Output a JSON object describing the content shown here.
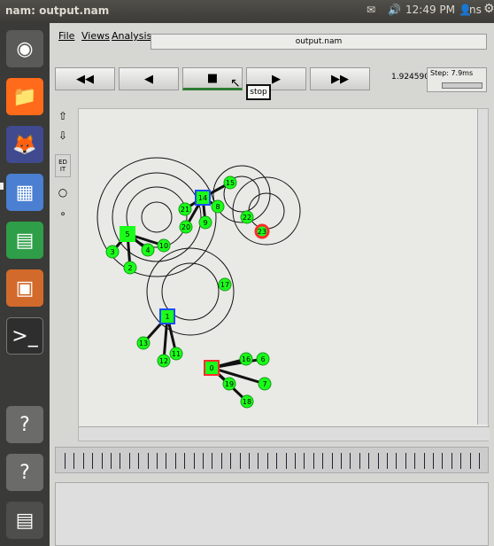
{
  "panel": {
    "title": "nam: output.nam",
    "clock": "12:49 PM",
    "user": "ns"
  },
  "menu": {
    "file": "File",
    "views": "Views",
    "analysis": "Analysis"
  },
  "filename": "output.nam",
  "controls": {
    "rewind_icon": "rewind-icon",
    "back_icon": "back-icon",
    "stop_icon": "stop-icon",
    "play_icon": "play-icon",
    "fastforward_icon": "fastforward-icon",
    "time": "1.924590",
    "step_label": "Step: 7.9ms",
    "tooltip": "stop"
  },
  "side_tools": {
    "edit": "ED IT"
  },
  "nodes": [
    {
      "id": "0",
      "color": "#ff2b2b",
      "type": "square"
    },
    {
      "id": "1",
      "color": "#1e4cff",
      "type": "square"
    },
    {
      "id": "2",
      "color": "#1aff1a",
      "type": "circle"
    },
    {
      "id": "3",
      "color": "#1aff1a",
      "type": "circle"
    },
    {
      "id": "4",
      "color": "#1aff1a",
      "type": "circle"
    },
    {
      "id": "5",
      "color": "#1aff1a",
      "type": "square"
    },
    {
      "id": "6",
      "color": "#1aff1a",
      "type": "circle"
    },
    {
      "id": "7",
      "color": "#1aff1a",
      "type": "circle"
    },
    {
      "id": "8",
      "color": "#1aff1a",
      "type": "circle"
    },
    {
      "id": "9",
      "color": "#1aff1a",
      "type": "circle"
    },
    {
      "id": "10",
      "color": "#1aff1a",
      "type": "circle"
    },
    {
      "id": "11",
      "color": "#1aff1a",
      "type": "circle"
    },
    {
      "id": "12",
      "color": "#1aff1a",
      "type": "circle"
    },
    {
      "id": "13",
      "color": "#1aff1a",
      "type": "circle"
    },
    {
      "id": "14",
      "color": "#1e4cff",
      "type": "square"
    },
    {
      "id": "15",
      "color": "#1aff1a",
      "type": "circle"
    },
    {
      "id": "16",
      "color": "#1aff1a",
      "type": "circle"
    },
    {
      "id": "17",
      "color": "#1aff1a",
      "type": "circle"
    },
    {
      "id": "18",
      "color": "#1aff1a",
      "type": "circle"
    },
    {
      "id": "19",
      "color": "#1aff1a",
      "type": "circle"
    },
    {
      "id": "20",
      "color": "#1aff1a",
      "type": "circle"
    },
    {
      "id": "21",
      "color": "#1aff1a",
      "type": "circle"
    },
    {
      "id": "22",
      "color": "#1aff1a",
      "type": "circle"
    },
    {
      "id": "23",
      "color": "#ff2b2b",
      "type": "circle"
    }
  ]
}
